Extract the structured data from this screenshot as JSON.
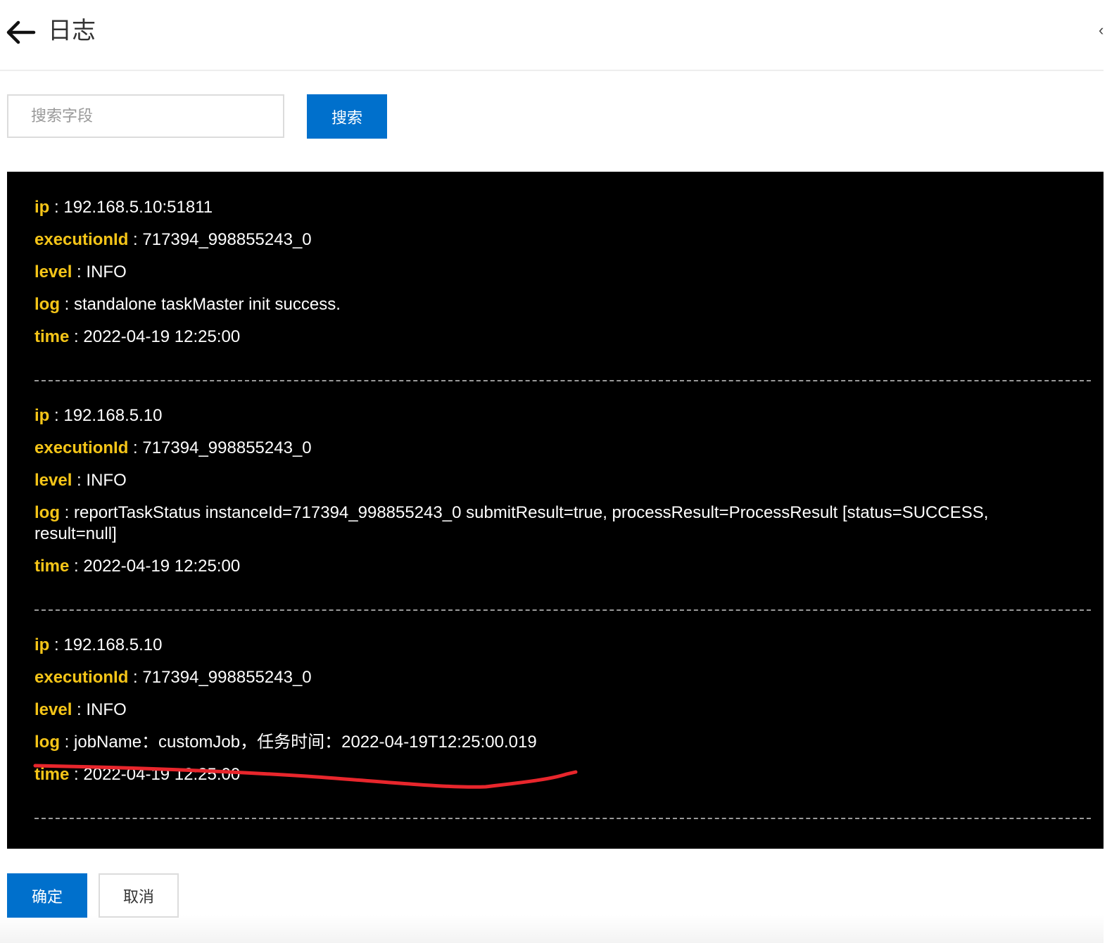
{
  "header": {
    "title": "日志",
    "back_icon": "arrow-left-icon",
    "close_icon": "close-icon"
  },
  "search": {
    "placeholder": "搜索字段",
    "value": "",
    "button_label": "搜索"
  },
  "log_entries": [
    {
      "fields": [
        {
          "key": "ip",
          "value": "192.168.5.10:51811"
        },
        {
          "key": "executionId",
          "value": "717394_998855243_0"
        },
        {
          "key": "level",
          "value": "INFO"
        },
        {
          "key": "log",
          "value": "standalone taskMaster init success."
        },
        {
          "key": "time",
          "value": "2022-04-19 12:25:00"
        }
      ]
    },
    {
      "fields": [
        {
          "key": "ip",
          "value": "192.168.5.10"
        },
        {
          "key": "executionId",
          "value": "717394_998855243_0"
        },
        {
          "key": "level",
          "value": "INFO"
        },
        {
          "key": "log",
          "value": "reportTaskStatus instanceId=717394_998855243_0 submitResult=true, processResult=ProcessResult [status=SUCCESS, result=null]"
        },
        {
          "key": "time",
          "value": "2022-04-19 12:25:00"
        }
      ]
    },
    {
      "fields": [
        {
          "key": "ip",
          "value": "192.168.5.10"
        },
        {
          "key": "executionId",
          "value": "717394_998855243_0"
        },
        {
          "key": "level",
          "value": "INFO"
        },
        {
          "key": "log",
          "value": "jobName：customJob，任务时间：2022-04-19T12:25:00.019"
        },
        {
          "key": "time",
          "value": "2022-04-19 12:25:00"
        }
      ]
    }
  ],
  "separator": " : ",
  "footer": {
    "ok_label": "确定",
    "cancel_label": "取消"
  },
  "colors": {
    "accent": "#0070cc",
    "log_background": "#000000",
    "log_key": "#f5c518",
    "log_value": "#ffffff",
    "annotation_stroke": "#e8262c"
  }
}
